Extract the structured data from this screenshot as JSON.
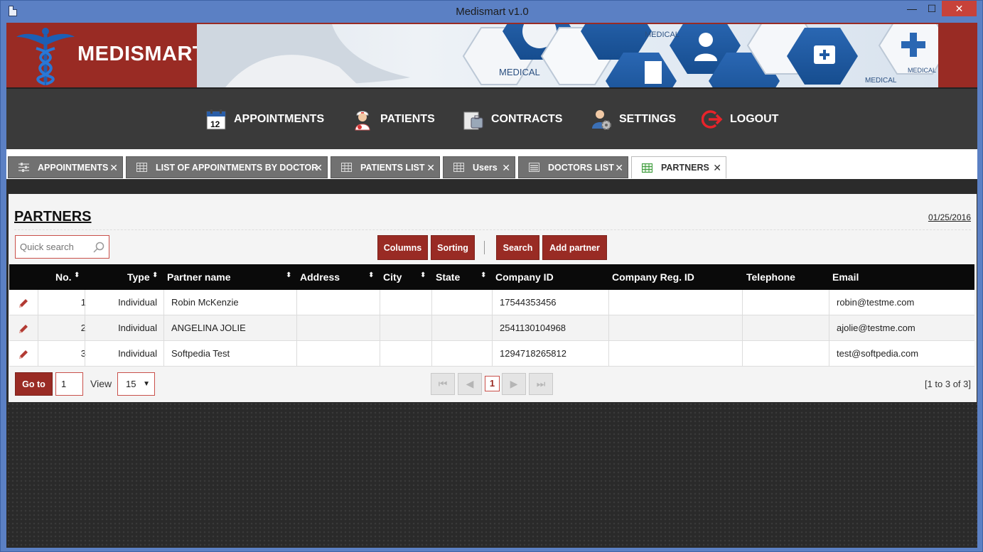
{
  "window": {
    "title": "Medismart v1.0",
    "min_glyph": "—",
    "max_glyph": "☐",
    "close_glyph": "✕"
  },
  "brand": {
    "name": "MEDISMART",
    "accent_color": "#992b24"
  },
  "banner": {
    "labels": [
      "MEDICAL",
      "MEDICAL",
      "MEDICAL",
      "MEDICAL"
    ]
  },
  "nav": {
    "items": [
      {
        "label": "APPOINTMENTS",
        "icon": "calendar-icon"
      },
      {
        "label": "PATIENTS",
        "icon": "nurse-icon"
      },
      {
        "label": "CONTRACTS",
        "icon": "briefcase-icon"
      },
      {
        "label": "SETTINGS",
        "icon": "user-gear-icon"
      },
      {
        "label": "LOGOUT",
        "icon": "logout-icon"
      }
    ]
  },
  "tabs": [
    {
      "label": "APPOINTMENTS",
      "icon": "sliders-icon",
      "active": false
    },
    {
      "label": "LIST OF APPOINTMENTS BY DOCTOR",
      "icon": "grid-icon",
      "active": false
    },
    {
      "label": "PATIENTS LIST",
      "icon": "grid-icon",
      "active": false
    },
    {
      "label": "Users",
      "icon": "grid-icon",
      "active": false
    },
    {
      "label": "DOCTORS LIST",
      "icon": "form-icon",
      "active": false
    },
    {
      "label": "PARTNERS",
      "icon": "grid-icon",
      "active": true
    }
  ],
  "tab_close_glyph": "✕",
  "page": {
    "title": "PARTNERS",
    "date": "01/25/2016"
  },
  "search": {
    "placeholder": "Quick search"
  },
  "toolbar": {
    "columns_label": "Columns",
    "sorting_label": "Sorting",
    "search_label": "Search",
    "add_label": "Add partner"
  },
  "table": {
    "sort_glyph": "⬍",
    "headers": [
      "No.",
      "Type",
      "Partner name",
      "Address",
      "City",
      "State",
      "Company ID",
      "Company Reg. ID",
      "Telephone",
      "Email"
    ],
    "rows": [
      {
        "no": "1",
        "type": "Individual",
        "name": "Robin McKenzie",
        "address": "",
        "city": "",
        "state": "",
        "company_id": "17544353456",
        "reg_id": "",
        "telephone": "",
        "email": "robin@testme.com"
      },
      {
        "no": "2",
        "type": "Individual",
        "name": "ANGELINA JOLIE",
        "address": "",
        "city": "",
        "state": "",
        "company_id": "2541130104968",
        "reg_id": "",
        "telephone": "",
        "email": "ajolie@testme.com"
      },
      {
        "no": "3",
        "type": "Individual",
        "name": "Softpedia Test",
        "address": "",
        "city": "",
        "state": "",
        "company_id": "1294718265812",
        "reg_id": "",
        "telephone": "",
        "email": "test@softpedia.com"
      }
    ]
  },
  "pager": {
    "goto_label": "Go to",
    "goto_value": "1",
    "view_label": "View",
    "view_value": "15",
    "current_page": "1",
    "first_glyph": "⏮",
    "prev_glyph": "◀",
    "next_glyph": "▶",
    "last_glyph": "⏭",
    "info": "[1 to 3 of 3]"
  }
}
